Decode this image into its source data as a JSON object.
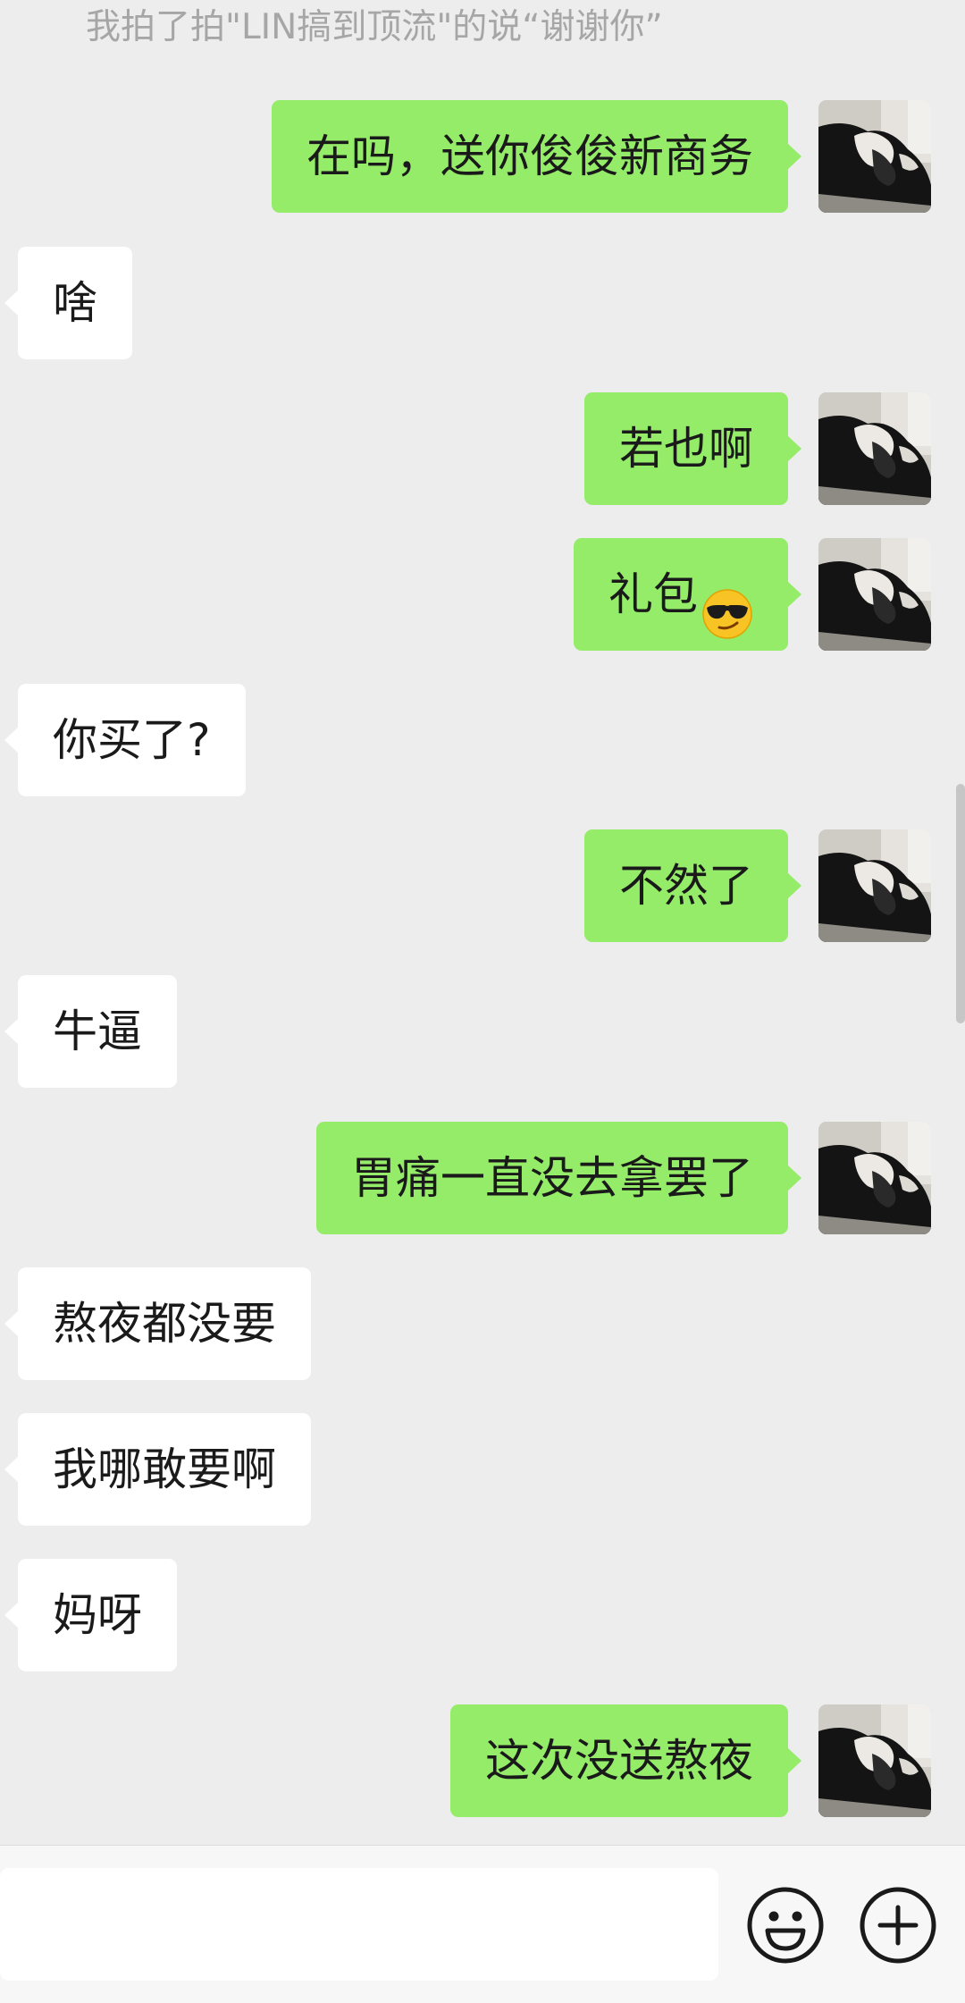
{
  "system_notice": "我拍了拍\"LIN搞到顶流\"的说“谢谢你”",
  "messages": [
    {
      "side": "right",
      "text": "在吗，送你俊俊新商务"
    },
    {
      "side": "left",
      "text": "啥"
    },
    {
      "side": "right",
      "text": "若也啊"
    },
    {
      "side": "right",
      "text": "礼包",
      "emoji": "smirking-sunglasses-emoji"
    },
    {
      "side": "left",
      "text": "你买了?"
    },
    {
      "side": "right",
      "text": "不然了"
    },
    {
      "side": "left",
      "text": "牛逼"
    },
    {
      "side": "right",
      "text": "胃痛一直没去拿罢了"
    },
    {
      "side": "left",
      "text": "熬夜都没要"
    },
    {
      "side": "left",
      "text": "我哪敢要啊"
    },
    {
      "side": "left",
      "text": "妈呀"
    },
    {
      "side": "right",
      "text": "这次没送熬夜"
    }
  ],
  "input_bar": {
    "text_value": "",
    "emoji_icon": "smiley-face-icon",
    "more_icon": "plus-circle-icon"
  },
  "colors": {
    "background": "#ededed",
    "sent_bubble": "#95ec69",
    "received_bubble": "#ffffff",
    "notice_text": "#a6a6a6"
  }
}
